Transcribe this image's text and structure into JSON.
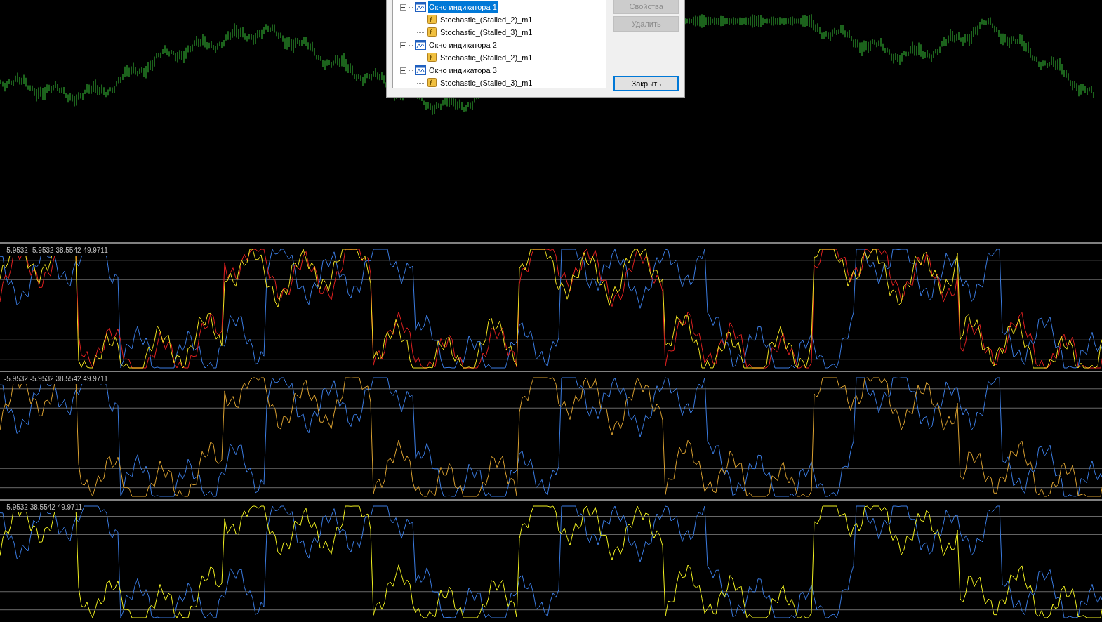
{
  "chart": {
    "kind": "candles"
  },
  "panes": [
    {
      "label": "-5.9532 -5.9532 38.5542 49.9711",
      "series": [
        {
          "color": "#3a7be0"
        },
        {
          "color": "#e02020"
        },
        {
          "color": "#f0e020"
        }
      ]
    },
    {
      "label": "-5.9532 -5.9532 38.5542 49.9711",
      "series": [
        {
          "color": "#3a7be0"
        },
        {
          "color": "#d9a030"
        }
      ]
    },
    {
      "label": "-5.9532 38.5542 49.9711",
      "series": [
        {
          "color": "#3a7be0"
        },
        {
          "color": "#f0f020"
        }
      ]
    }
  ],
  "dialog": {
    "tree": [
      {
        "label": "Окно индикатора 1",
        "selected": true,
        "expanded": true,
        "children": [
          {
            "label": "Stochastic_(Stalled_2)_m1",
            "selected": false
          },
          {
            "label": "Stochastic_(Stalled_3)_m1",
            "selected": false
          }
        ]
      },
      {
        "label": "Окно индикатора 2",
        "selected": false,
        "expanded": true,
        "children": [
          {
            "label": "Stochastic_(Stalled_2)_m1",
            "selected": false
          }
        ]
      },
      {
        "label": "Окно индикатора 3",
        "selected": false,
        "expanded": true,
        "children": [
          {
            "label": "Stochastic_(Stalled_3)_m1",
            "selected": false
          }
        ]
      }
    ],
    "buttons": [
      {
        "label": "Свойства",
        "disabled": true
      },
      {
        "label": "Удалить",
        "disabled": true
      },
      {
        "label": "Закрыть",
        "disabled": false,
        "default": true
      }
    ]
  }
}
